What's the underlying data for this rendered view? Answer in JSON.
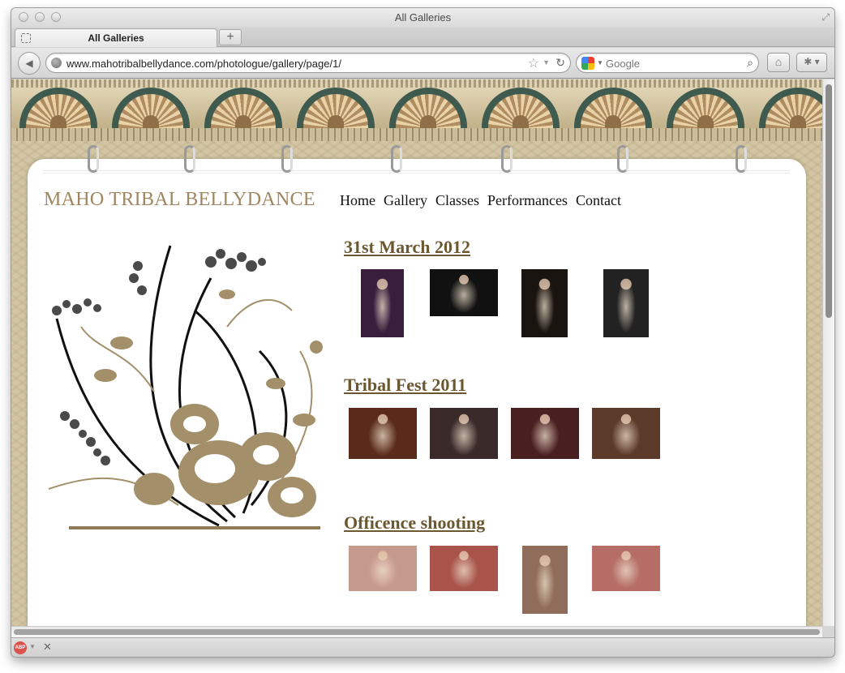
{
  "browser": {
    "window_title": "All Galleries",
    "tab_label": "All Galleries",
    "new_tab_label": "+",
    "url": "www.mahotribalbellydance.com/photologue/gallery/page/1/",
    "search_placeholder": "Google"
  },
  "site": {
    "title": "MAHO TRIBAL BELLYDANCE",
    "nav": [
      "Home",
      "Gallery",
      "Classes",
      "Performances",
      "Contact"
    ]
  },
  "galleries": [
    {
      "title": "31st March 2012",
      "photos": [
        {
          "name": "dancer-purple-stage-photo",
          "bg": "#3a1f3d"
        },
        {
          "name": "dancer-floor-pose-photo",
          "bg": "#111111"
        },
        {
          "name": "dancer-white-skirt-photo",
          "bg": "#1a1410"
        },
        {
          "name": "dancer-silver-costume-photo",
          "bg": "#222222"
        }
      ]
    },
    {
      "title": "Tribal Fest 2011",
      "photos": [
        {
          "name": "tribal-fest-stage-photo",
          "bg": "#5a2b1a"
        },
        {
          "name": "tribal-fest-two-dancers-photo",
          "bg": "#3b2a2a"
        },
        {
          "name": "tribal-fest-group-dance-photo",
          "bg": "#4a1f22"
        },
        {
          "name": "tribal-fest-portrait-photo",
          "bg": "#5c3a2a"
        }
      ]
    },
    {
      "title": "Officence shooting",
      "photos": [
        {
          "name": "shooting-group-1-photo",
          "bg": "#c79a8e"
        },
        {
          "name": "shooting-group-2-photo",
          "bg": "#a8544a"
        },
        {
          "name": "shooting-solo-photo",
          "bg": "#8f6d5a"
        },
        {
          "name": "shooting-group-3-photo",
          "bg": "#b56d66"
        }
      ]
    }
  ],
  "colors": {
    "title_brown": "#a08660",
    "gallery_heading": "#6b5730",
    "background_stone": "#d3c6a4"
  }
}
